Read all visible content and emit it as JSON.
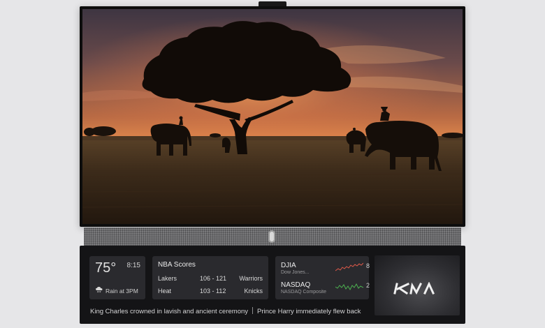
{
  "weather": {
    "temperature": "75°",
    "time": "8:15",
    "forecast": "Rain at 3PM",
    "icon": "rain-cloud-icon"
  },
  "nba": {
    "title": "NBA Scores",
    "games": [
      {
        "home": "Lakers",
        "score": "106 - 121",
        "away": "Warriors"
      },
      {
        "home": "Heat",
        "score": "103 - 112",
        "away": "Knicks"
      }
    ]
  },
  "stocks": {
    "items": [
      {
        "symbol": "DJIA",
        "name": "Dow Jones...",
        "trend_color": "#e05a4a",
        "cut_value": "8"
      },
      {
        "symbol": "NASDAQ",
        "name": "NASDAQ Composite",
        "trend_color": "#4caf50",
        "cut_value": "2"
      }
    ]
  },
  "ad": {
    "brand": "KIA",
    "logo_icon": "kia-logo"
  },
  "ticker": {
    "headlines": [
      "King Charles crowned in lavish and ancient ceremony",
      "Prince Harry immediately flew back"
    ]
  }
}
